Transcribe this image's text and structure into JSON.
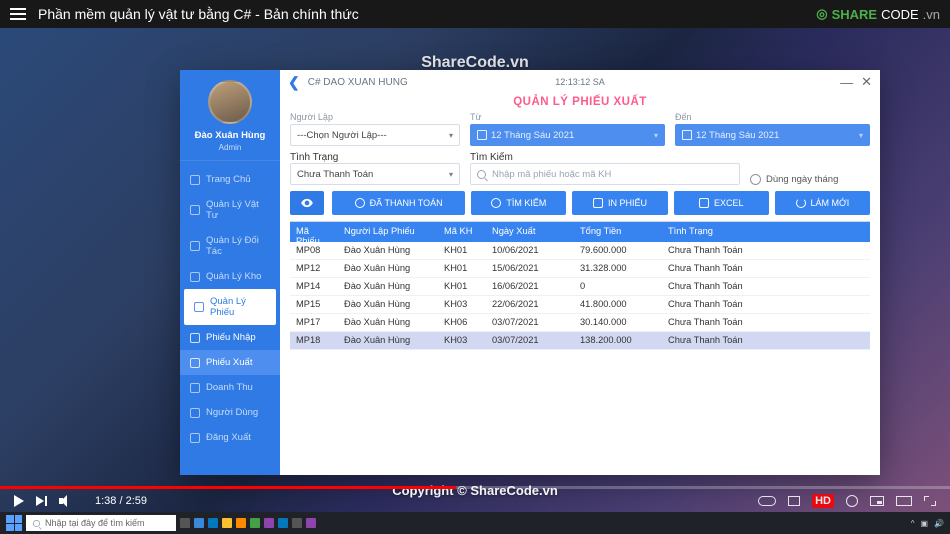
{
  "youtube": {
    "title": "Phần mềm quản lý vật tư bằng C# - Bản chính thức",
    "brand_share": "SHARE",
    "brand_code": "CODE",
    "brand_tld": ".vn",
    "watermark": "ShareCode.vn",
    "copyright": "Copyright © ShareCode.vn",
    "time_elapsed": "1:38",
    "time_total": "2:59",
    "hd_badge": "HD"
  },
  "taskbar": {
    "search_placeholder": "Nhập tại đây để tìm kiếm"
  },
  "app": {
    "user": {
      "name": "Đào Xuân Hùng",
      "role": "Admin"
    },
    "title": "C# DAO XUAN HUNG",
    "clock": "12:13:12  SA",
    "heading": "QUẢN LÝ PHIẾU XUẤT",
    "nav": {
      "home": "Trang Chủ",
      "vattu": "Quản Lý Vật Tư",
      "doitac": "Quản Lý Đối Tác",
      "kho": "Quản Lý Kho",
      "phieu": "Quản Lý Phiếu",
      "phieunhap": "Phiếu Nhập",
      "phieuxuat": "Phiếu Xuất",
      "doanhthu": "Doanh Thu",
      "nguoidung": "Người Dùng",
      "dangxuat": "Đăng Xuất"
    },
    "filters": {
      "nguoilap_label": "Người Lập",
      "nguoilap_value": "---Chọn Người Lập---",
      "tu_label": "Từ",
      "den_label": "Đến",
      "date_from": "12 Tháng Sáu 2021",
      "date_to": "12 Tháng Sáu 2021",
      "tinhtrang_label": "Tình Trạng",
      "tinhtrang_value": "Chưa Thanh Toán",
      "timkiem_label": "Tìm Kiếm",
      "timkiem_placeholder": "Nhập mã phiếu hoặc mã KH",
      "checkbox_label": "Dùng ngày tháng"
    },
    "buttons": {
      "dathanhtoan": "ĐÃ THANH TOÁN",
      "timkiem": "TÌM KIẾM",
      "inphieu": "IN PHIẾU",
      "excel": "EXCEL",
      "lammoi": "LÀM MỚI"
    },
    "table": {
      "headers": {
        "maphieu": "Mã Phiếu",
        "nguoilap": "Người Lập Phiếu",
        "makh": "Mã KH",
        "ngayxuat": "Ngày Xuất",
        "tongtien": "Tổng Tiền",
        "tinhtrang": "Tình Trạng"
      },
      "rows": [
        {
          "id": "MP08",
          "name": "Đào Xuân Hùng",
          "kh": "KH01",
          "date": "10/06/2021",
          "amount": "79.600.000",
          "status": "Chưa Thanh Toán"
        },
        {
          "id": "MP12",
          "name": "Đào Xuân Hùng",
          "kh": "KH01",
          "date": "15/06/2021",
          "amount": "31.328.000",
          "status": "Chưa Thanh Toán"
        },
        {
          "id": "MP14",
          "name": "Đào Xuân Hùng",
          "kh": "KH01",
          "date": "16/06/2021",
          "amount": "0",
          "status": "Chưa Thanh Toán"
        },
        {
          "id": "MP15",
          "name": "Đào Xuân Hùng",
          "kh": "KH03",
          "date": "22/06/2021",
          "amount": "41.800.000",
          "status": "Chưa Thanh Toán"
        },
        {
          "id": "MP17",
          "name": "Đào Xuân Hùng",
          "kh": "KH06",
          "date": "03/07/2021",
          "amount": "30.140.000",
          "status": "Chưa Thanh Toán"
        },
        {
          "id": "MP18",
          "name": "Đào Xuân Hùng",
          "kh": "KH03",
          "date": "03/07/2021",
          "amount": "138.200.000",
          "status": "Chưa Thanh Toán"
        }
      ]
    }
  }
}
